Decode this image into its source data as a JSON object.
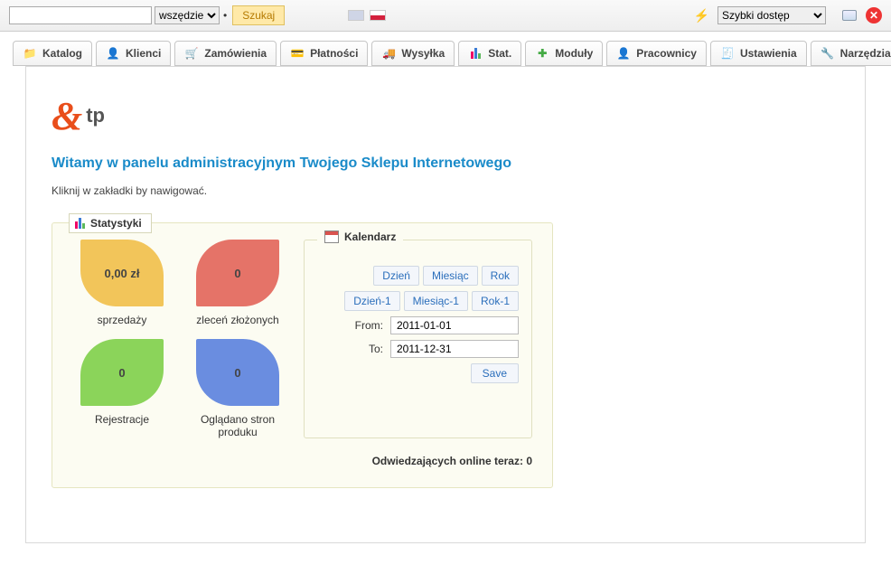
{
  "topbar": {
    "search_select": "wszędzie",
    "search_btn": "Szukaj",
    "quick_access": "Szybki dostęp"
  },
  "tabs": [
    {
      "label": "Katalog"
    },
    {
      "label": "Klienci"
    },
    {
      "label": "Zamówienia"
    },
    {
      "label": "Płatności"
    },
    {
      "label": "Wysyłka"
    },
    {
      "label": "Stat."
    },
    {
      "label": "Moduły"
    },
    {
      "label": "Pracownicy"
    },
    {
      "label": "Ustawienia"
    },
    {
      "label": "Narzędzia"
    }
  ],
  "logo_text": "tp",
  "welcome": "Witamy w panelu administracyjnym Twojego Sklepu Internetowego",
  "subtitle": "Kliknij w zakładki by nawigować.",
  "stats_title": "Statystyki",
  "stats": {
    "sales": {
      "value": "0,00 zł",
      "label": "sprzedaży"
    },
    "orders": {
      "value": "0",
      "label": "zleceń złożonych"
    },
    "registrations": {
      "value": "0",
      "label": "Rejestracje"
    },
    "pageviews": {
      "value": "0",
      "label": "Oglądano stron produku"
    }
  },
  "calendar": {
    "title": "Kalendarz",
    "row1": [
      "Dzień",
      "Miesiąc",
      "Rok"
    ],
    "row2": [
      "Dzień-1",
      "Miesiąc-1",
      "Rok-1"
    ],
    "from_label": "From:",
    "to_label": "To:",
    "from_value": "2011-01-01",
    "to_value": "2011-12-31",
    "save": "Save"
  },
  "visitors": {
    "label": "Odwiedzających online teraz:",
    "value": "0"
  }
}
